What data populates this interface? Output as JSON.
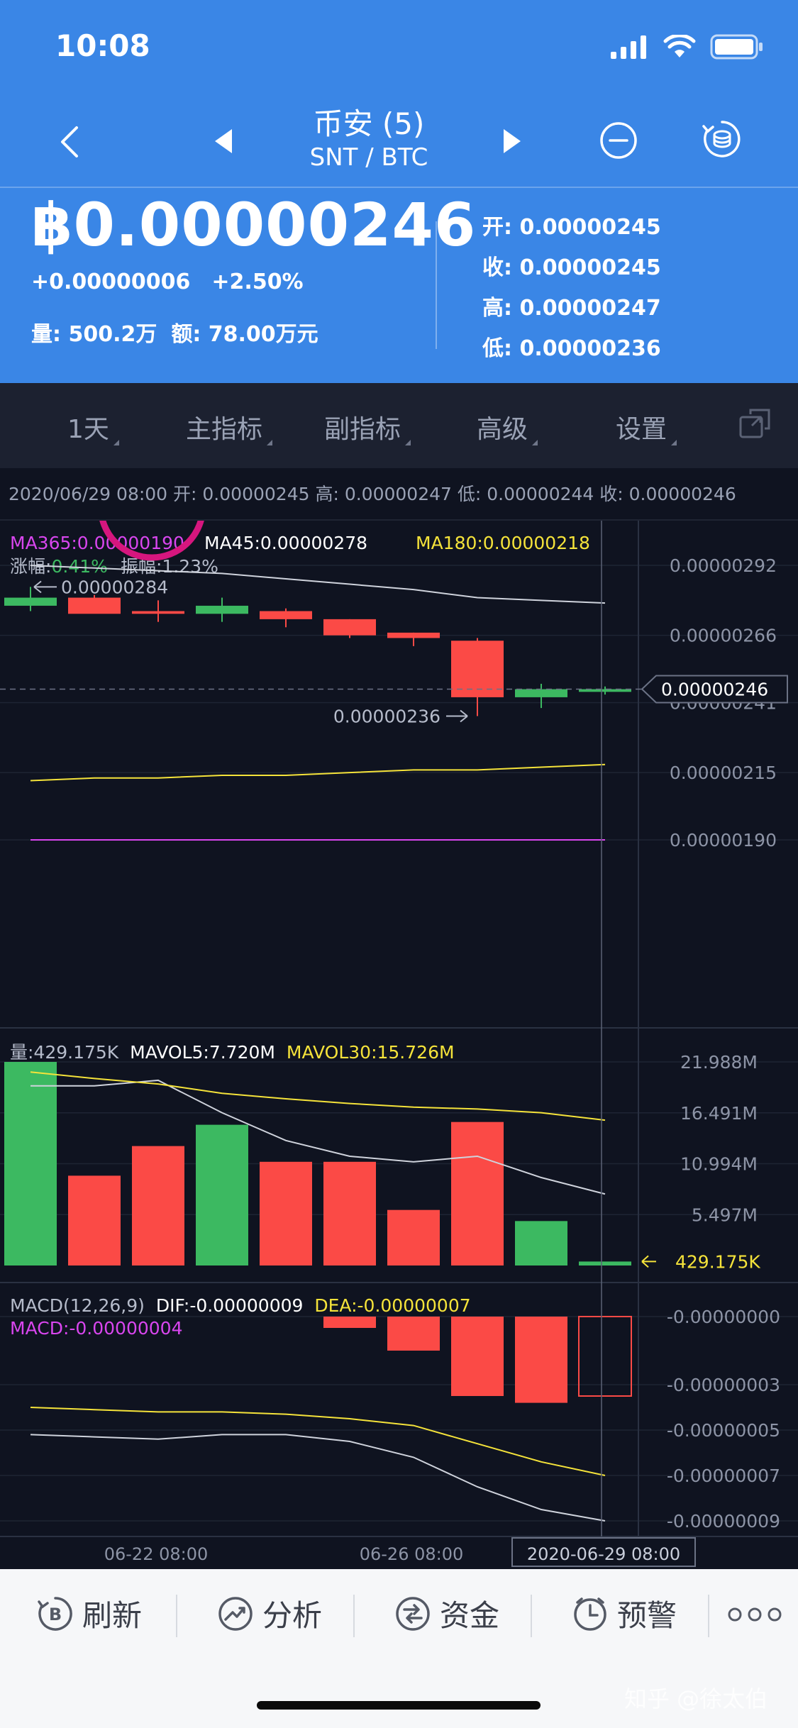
{
  "status": {
    "time": "10:08"
  },
  "nav": {
    "title": "币安 (5)",
    "pair": "SNT / BTC"
  },
  "ticker": {
    "price": "฿0.00000246",
    "change": "+0.00000006",
    "change_pct": "+2.50%",
    "volume": "量: 500.2万",
    "amount": "额: 78.00万元",
    "open": "开: 0.00000245",
    "close": "收: 0.00000245",
    "high": "高: 0.00000247",
    "low": "低: 0.00000236"
  },
  "toolbar": {
    "items": [
      "1天",
      "主指标",
      "副指标",
      "高级",
      "设置"
    ]
  },
  "info_bar": "2020/06/29 08:00 开: 0.00000245 高: 0.00000247 低: 0.00000244 收: 0.00000246",
  "colors": {
    "up": "#3cb961",
    "down": "#fb4a46",
    "header": "#3a86e6",
    "bg": "#0f1320",
    "ma45": "#ffffff",
    "ma180": "#f5e33a",
    "ma365": "#d946ef"
  },
  "main_chart": {
    "legend": {
      "ma365": "MA365:0.00000190",
      "ma45": "MA45:0.00000278",
      "ma180": "MA180:0.00000218"
    },
    "legend2": {
      "chg_label": "涨幅:",
      "chg_val": "0.41%",
      "amp": "振幅:1.23%"
    },
    "y_ticks": [
      "0.00000292",
      "0.00000266",
      "0.00000241",
      "0.00000215",
      "0.00000190"
    ],
    "current_price": "0.00000246",
    "high_marker": "0.00000284",
    "low_marker": "0.00000236"
  },
  "volume_chart": {
    "legend": {
      "vol": "量:429.175K",
      "mavol5": "MAVOL5:7.720M",
      "mavol30": "MAVOL30:15.726M"
    },
    "y_ticks": [
      "21.988M",
      "16.491M",
      "10.994M",
      "5.497M"
    ],
    "current": "429.175K"
  },
  "macd_chart": {
    "legend": {
      "macd": "MACD(12,26,9)",
      "dif": "DIF:-0.00000009",
      "dea": "DEA:-0.00000007",
      "macd_val": "MACD:-0.00000004"
    },
    "y_ticks": [
      "-0.00000000",
      "-0.00000003",
      "-0.00000005",
      "-0.00000007",
      "-0.00000009"
    ]
  },
  "x_axis": {
    "labels": [
      "06-22 08:00",
      "06-26 08:00"
    ],
    "cursor_label": "2020-06-29 08:00"
  },
  "chart_data": {
    "type": "candlestick",
    "candles": [
      {
        "o": 2.77e-06,
        "h": 2.84e-06,
        "l": 2.75e-06,
        "c": 2.8e-06,
        "vol": 21.988,
        "macd": null
      },
      {
        "o": 2.8e-06,
        "h": 2.81e-06,
        "l": 2.75e-06,
        "c": 2.74e-06,
        "vol": 9.7,
        "macd": null
      },
      {
        "o": 2.75e-06,
        "h": 2.79e-06,
        "l": 2.71e-06,
        "c": 2.74e-06,
        "vol": 12.9,
        "macd": null
      },
      {
        "o": 2.74e-06,
        "h": 2.8e-06,
        "l": 2.71e-06,
        "c": 2.77e-06,
        "vol": 15.2,
        "macd": null
      },
      {
        "o": 2.75e-06,
        "h": 2.76e-06,
        "l": 2.69e-06,
        "c": 2.72e-06,
        "vol": 11.2,
        "macd": null
      },
      {
        "o": 2.72e-06,
        "h": 2.72e-06,
        "l": 2.65e-06,
        "c": 2.66e-06,
        "vol": 11.2,
        "macd": -5e-10
      },
      {
        "o": 2.67e-06,
        "h": 2.67e-06,
        "l": 2.62e-06,
        "c": 2.65e-06,
        "vol": 6.0,
        "macd": -1.5e-09
      },
      {
        "o": 2.64e-06,
        "h": 2.65e-06,
        "l": 2.36e-06,
        "c": 2.43e-06,
        "vol": 15.5,
        "macd": -3.5e-09
      },
      {
        "o": 2.43e-06,
        "h": 2.48e-06,
        "l": 2.39e-06,
        "c": 2.46e-06,
        "vol": 4.8,
        "macd": -3.8e-09
      },
      {
        "o": 2.45e-06,
        "h": 2.47e-06,
        "l": 2.44e-06,
        "c": 2.46e-06,
        "vol": 0.429,
        "macd": -3.5e-09
      }
    ],
    "ma45": [
      2.92e-06,
      2.91e-06,
      2.9e-06,
      2.89e-06,
      2.87e-06,
      2.85e-06,
      2.83e-06,
      2.8e-06,
      2.79e-06,
      2.78e-06
    ],
    "ma180": [
      2.12e-06,
      2.13e-06,
      2.13e-06,
      2.14e-06,
      2.14e-06,
      2.15e-06,
      2.16e-06,
      2.16e-06,
      2.17e-06,
      2.18e-06
    ],
    "ma365": [
      1.9e-06,
      1.9e-06,
      1.9e-06,
      1.9e-06,
      1.9e-06,
      1.9e-06,
      1.9e-06,
      1.9e-06,
      1.9e-06,
      1.9e-06
    ],
    "mavol5": [
      19.4,
      19.4,
      20.0,
      16.5,
      13.5,
      11.8,
      11.2,
      11.8,
      9.5,
      7.72
    ],
    "mavol30": [
      20.9,
      20.2,
      19.6,
      18.6,
      18.0,
      17.5,
      17.1,
      16.9,
      16.5,
      15.7
    ],
    "dif": [
      -5.2e-09,
      -5.3e-09,
      -5.4e-09,
      -5.2e-09,
      -5.2e-09,
      -5.5e-09,
      -6.2e-09,
      -7.5e-09,
      -8.5e-09,
      -9e-09
    ],
    "dea": [
      -4e-09,
      -4.1e-09,
      -4.2e-09,
      -4.2e-09,
      -4.3e-09,
      -4.5e-09,
      -4.8e-09,
      -5.6e-09,
      -6.4e-09,
      -7e-09
    ],
    "price_ylim": [
      1.9e-06,
      2.92e-06
    ],
    "vol_ylim": [
      0,
      21.988
    ],
    "macd_ylim": [
      -9e-09,
      0.0
    ]
  },
  "bottom_bar": {
    "refresh": "刷新",
    "analysis": "分析",
    "funds": "资金",
    "alert": "预警"
  },
  "watermark": "知乎 @徐太伯"
}
